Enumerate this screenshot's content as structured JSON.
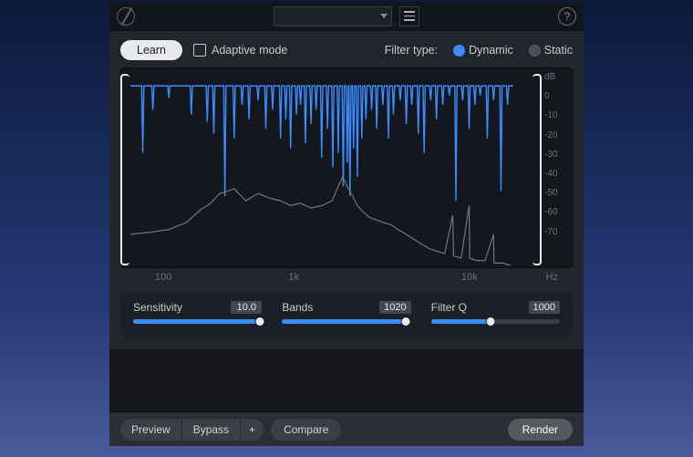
{
  "header": {
    "preset": "",
    "help_glyph": "?"
  },
  "controls": {
    "learn_label": "Learn",
    "adaptive_label": "Adaptive mode",
    "adaptive_checked": false,
    "filter_type_label": "Filter type:",
    "dynamic_label": "Dynamic",
    "static_label": "Static",
    "filter_type_value": "Dynamic"
  },
  "chart_data": {
    "type": "line",
    "xlabel": "Hz",
    "ylabel": "dB",
    "x_ticks": [
      "100",
      "1k",
      "10k"
    ],
    "y_ticks": [
      "dB",
      "0",
      "-10",
      "-20",
      "-30",
      "-40",
      "-50",
      "-60",
      "-70"
    ],
    "ylim": [
      -75,
      5
    ],
    "x_scale": "log",
    "x_range_hz": [
      20,
      20000
    ],
    "series": [
      {
        "name": "filter-notches",
        "color": "#3a8cff",
        "baseline_db": 0,
        "notches_db": [
          [
            25,
            -28
          ],
          [
            30,
            -10
          ],
          [
            40,
            -5
          ],
          [
            60,
            -12
          ],
          [
            80,
            -15
          ],
          [
            90,
            -20
          ],
          [
            110,
            -46
          ],
          [
            130,
            -22
          ],
          [
            150,
            -8
          ],
          [
            170,
            -14
          ],
          [
            200,
            -6
          ],
          [
            230,
            -18
          ],
          [
            260,
            -10
          ],
          [
            300,
            -22
          ],
          [
            330,
            -14
          ],
          [
            360,
            -26
          ],
          [
            400,
            -12
          ],
          [
            430,
            -8
          ],
          [
            470,
            -24
          ],
          [
            520,
            -16
          ],
          [
            570,
            -10
          ],
          [
            630,
            -30
          ],
          [
            700,
            -18
          ],
          [
            770,
            -34
          ],
          [
            850,
            -28
          ],
          [
            930,
            -42
          ],
          [
            1000,
            -32
          ],
          [
            1050,
            -46
          ],
          [
            1120,
            -26
          ],
          [
            1200,
            -38
          ],
          [
            1300,
            -22
          ],
          [
            1400,
            -14
          ],
          [
            1550,
            -10
          ],
          [
            1700,
            -18
          ],
          [
            1900,
            -8
          ],
          [
            2100,
            -22
          ],
          [
            2300,
            -12
          ],
          [
            2600,
            -6
          ],
          [
            2900,
            -16
          ],
          [
            3200,
            -8
          ],
          [
            3600,
            -20
          ],
          [
            4000,
            -28
          ],
          [
            4500,
            -6
          ],
          [
            5000,
            -14
          ],
          [
            5600,
            -8
          ],
          [
            6300,
            -4
          ],
          [
            7100,
            -48
          ],
          [
            8000,
            -6
          ],
          [
            9000,
            -18
          ],
          [
            10000,
            -8
          ],
          [
            11000,
            -4
          ],
          [
            12500,
            -22
          ],
          [
            14000,
            -6
          ],
          [
            16000,
            -44
          ],
          [
            18000,
            -8
          ]
        ]
      },
      {
        "name": "input-spectrum",
        "color": "#7a8088",
        "points_db": [
          [
            20,
            -62
          ],
          [
            30,
            -61
          ],
          [
            40,
            -60
          ],
          [
            55,
            -57
          ],
          [
            70,
            -52
          ],
          [
            85,
            -49
          ],
          [
            100,
            -45
          ],
          [
            130,
            -43
          ],
          [
            160,
            -48
          ],
          [
            200,
            -45
          ],
          [
            250,
            -47
          ],
          [
            300,
            -48
          ],
          [
            360,
            -50
          ],
          [
            430,
            -49
          ],
          [
            520,
            -51
          ],
          [
            630,
            -50
          ],
          [
            760,
            -48
          ],
          [
            850,
            -42
          ],
          [
            920,
            -38
          ],
          [
            1000,
            -42
          ],
          [
            1100,
            -46
          ],
          [
            1200,
            -50
          ],
          [
            1350,
            -53
          ],
          [
            1500,
            -55
          ],
          [
            1700,
            -56
          ],
          [
            1900,
            -57
          ],
          [
            2200,
            -58
          ],
          [
            2500,
            -60
          ],
          [
            2900,
            -62
          ],
          [
            3300,
            -64
          ],
          [
            3800,
            -66
          ],
          [
            4400,
            -68
          ],
          [
            5000,
            -69
          ],
          [
            5800,
            -70
          ],
          [
            6700,
            -54
          ],
          [
            6800,
            -71
          ],
          [
            7800,
            -72
          ],
          [
            9000,
            -50
          ],
          [
            9100,
            -72
          ],
          [
            10500,
            -73
          ],
          [
            12000,
            -73
          ],
          [
            14000,
            -62
          ],
          [
            14100,
            -74
          ],
          [
            16500,
            -74
          ],
          [
            19000,
            -75
          ]
        ]
      }
    ]
  },
  "sliders": {
    "sensitivity": {
      "label": "Sensitivity",
      "value": "10.0",
      "percent": 98
    },
    "bands": {
      "label": "Bands",
      "value": "1020",
      "percent": 96
    },
    "filter_q": {
      "label": "Filter Q",
      "value": "1000",
      "percent": 46
    }
  },
  "footer": {
    "preview": "Preview",
    "bypass": "Bypass",
    "add": "+",
    "compare": "Compare",
    "render": "Render"
  }
}
